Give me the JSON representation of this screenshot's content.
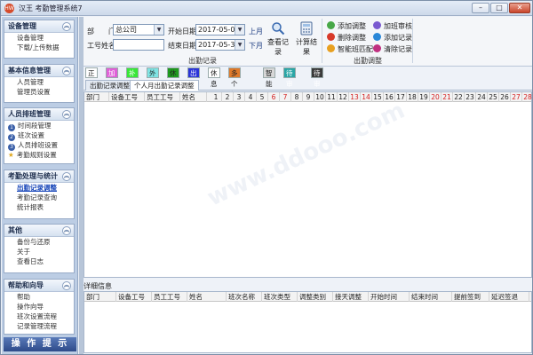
{
  "window": {
    "title": "汉王 考勤管理系统7",
    "min": "–",
    "max": "□",
    "close": "✕"
  },
  "sidebar": {
    "groups": [
      {
        "title": "设备管理",
        "items": [
          "设备管理",
          "下载/上传数据"
        ]
      },
      {
        "title": "基本信息管理",
        "items": [
          "人员管理",
          "管理员设置"
        ]
      },
      {
        "title": "人员排班管理",
        "items": [
          {
            "num": "1",
            "label": "时间段管理"
          },
          {
            "num": "2",
            "label": "班次设置"
          },
          {
            "num": "3",
            "label": "人员排班设置"
          },
          {
            "num": "★",
            "label": "考勤规则设置"
          }
        ]
      },
      {
        "title": "考勤处理与统计",
        "items": [
          "出勤记录调整",
          "考勤记录查询",
          "统计报表"
        ]
      },
      {
        "title": "其他",
        "items": [
          "备份与还原",
          "关于",
          "查看日志"
        ]
      },
      {
        "title": "帮助和向导",
        "items": [
          "帮助",
          "操作向导",
          "班次设置流程",
          "记录管理流程"
        ]
      }
    ],
    "tip": "操 作 提 示"
  },
  "toolbar": {
    "dept_label": "部　　门",
    "dept_value": "总公司",
    "name_label": "工号姓名",
    "name_value": "",
    "start_label": "开始日期",
    "start_value": "2017-05-01",
    "end_label": "结束日期",
    "end_value": "2017-05-31",
    "prev_month": "上月",
    "next_month": "下月",
    "query": "查看记录",
    "calc": "计算结果",
    "record_caption": "出勤记录",
    "adjust_caption": "出勤调整",
    "add_adjust": "添加调整",
    "delete_adjust": "删除调整",
    "smart_match": "智能班匹配",
    "overtime_review": "加班审核",
    "add_record": "添加记录",
    "clear_record": "清除记录"
  },
  "legend": [
    {
      "label": "正常",
      "bg": "#ffffff",
      "fg": "#222222"
    },
    {
      "label": "加班",
      "bg": "#e060d8",
      "fg": "#ffffff"
    },
    {
      "label": "补班",
      "bg": "#38e838",
      "fg": "#ffffff"
    },
    {
      "label": "外勤",
      "bg": "#7fe3e3",
      "fg": "#222222"
    },
    {
      "label": "休假",
      "bg": "#1f9a1f",
      "fg": "#222222"
    },
    {
      "label": "出差",
      "bg": "#2a34d8",
      "fg": "#ffffff"
    },
    {
      "label": "休息",
      "bg": "#ffffff",
      "fg": "#222222"
    },
    {
      "label": "多个调整",
      "bg": "#e07a2a",
      "fg": "#222222"
    },
    {
      "label": "智能",
      "bg": "#d7d7d7",
      "fg": "#222222"
    },
    {
      "label": "待审核",
      "bg": "#2aa6a6",
      "fg": "#ffffff"
    },
    {
      "label": "待审核网络数据",
      "bg": "#3a3a3a",
      "fg": "#ffffff"
    }
  ],
  "tabs": [
    "出勤记录调整",
    "个人月出勤记录调整"
  ],
  "grid": {
    "headers": [
      "部门",
      "设备工号",
      "员工工号",
      "姓名"
    ],
    "days": [
      "1",
      "2",
      "3",
      "4",
      "5",
      "6",
      "7",
      "8",
      "9",
      "10",
      "11",
      "12",
      "13",
      "14",
      "15",
      "16",
      "17",
      "18",
      "19",
      "20",
      "21",
      "22",
      "23",
      "24",
      "25",
      "26",
      "27",
      "28"
    ],
    "weekend_days": [
      "6",
      "7",
      "13",
      "14",
      "20",
      "21",
      "27",
      "28"
    ]
  },
  "detail": {
    "caption": "详细信息",
    "headers": [
      "部门",
      "设备工号",
      "员工工号",
      "姓名",
      "班次名称",
      "班次类型",
      "调整类别",
      "接天调整",
      "开始时间",
      "结束时间",
      "提前签到",
      "延迟签退"
    ]
  },
  "watermark": "www.ddooo.com"
}
